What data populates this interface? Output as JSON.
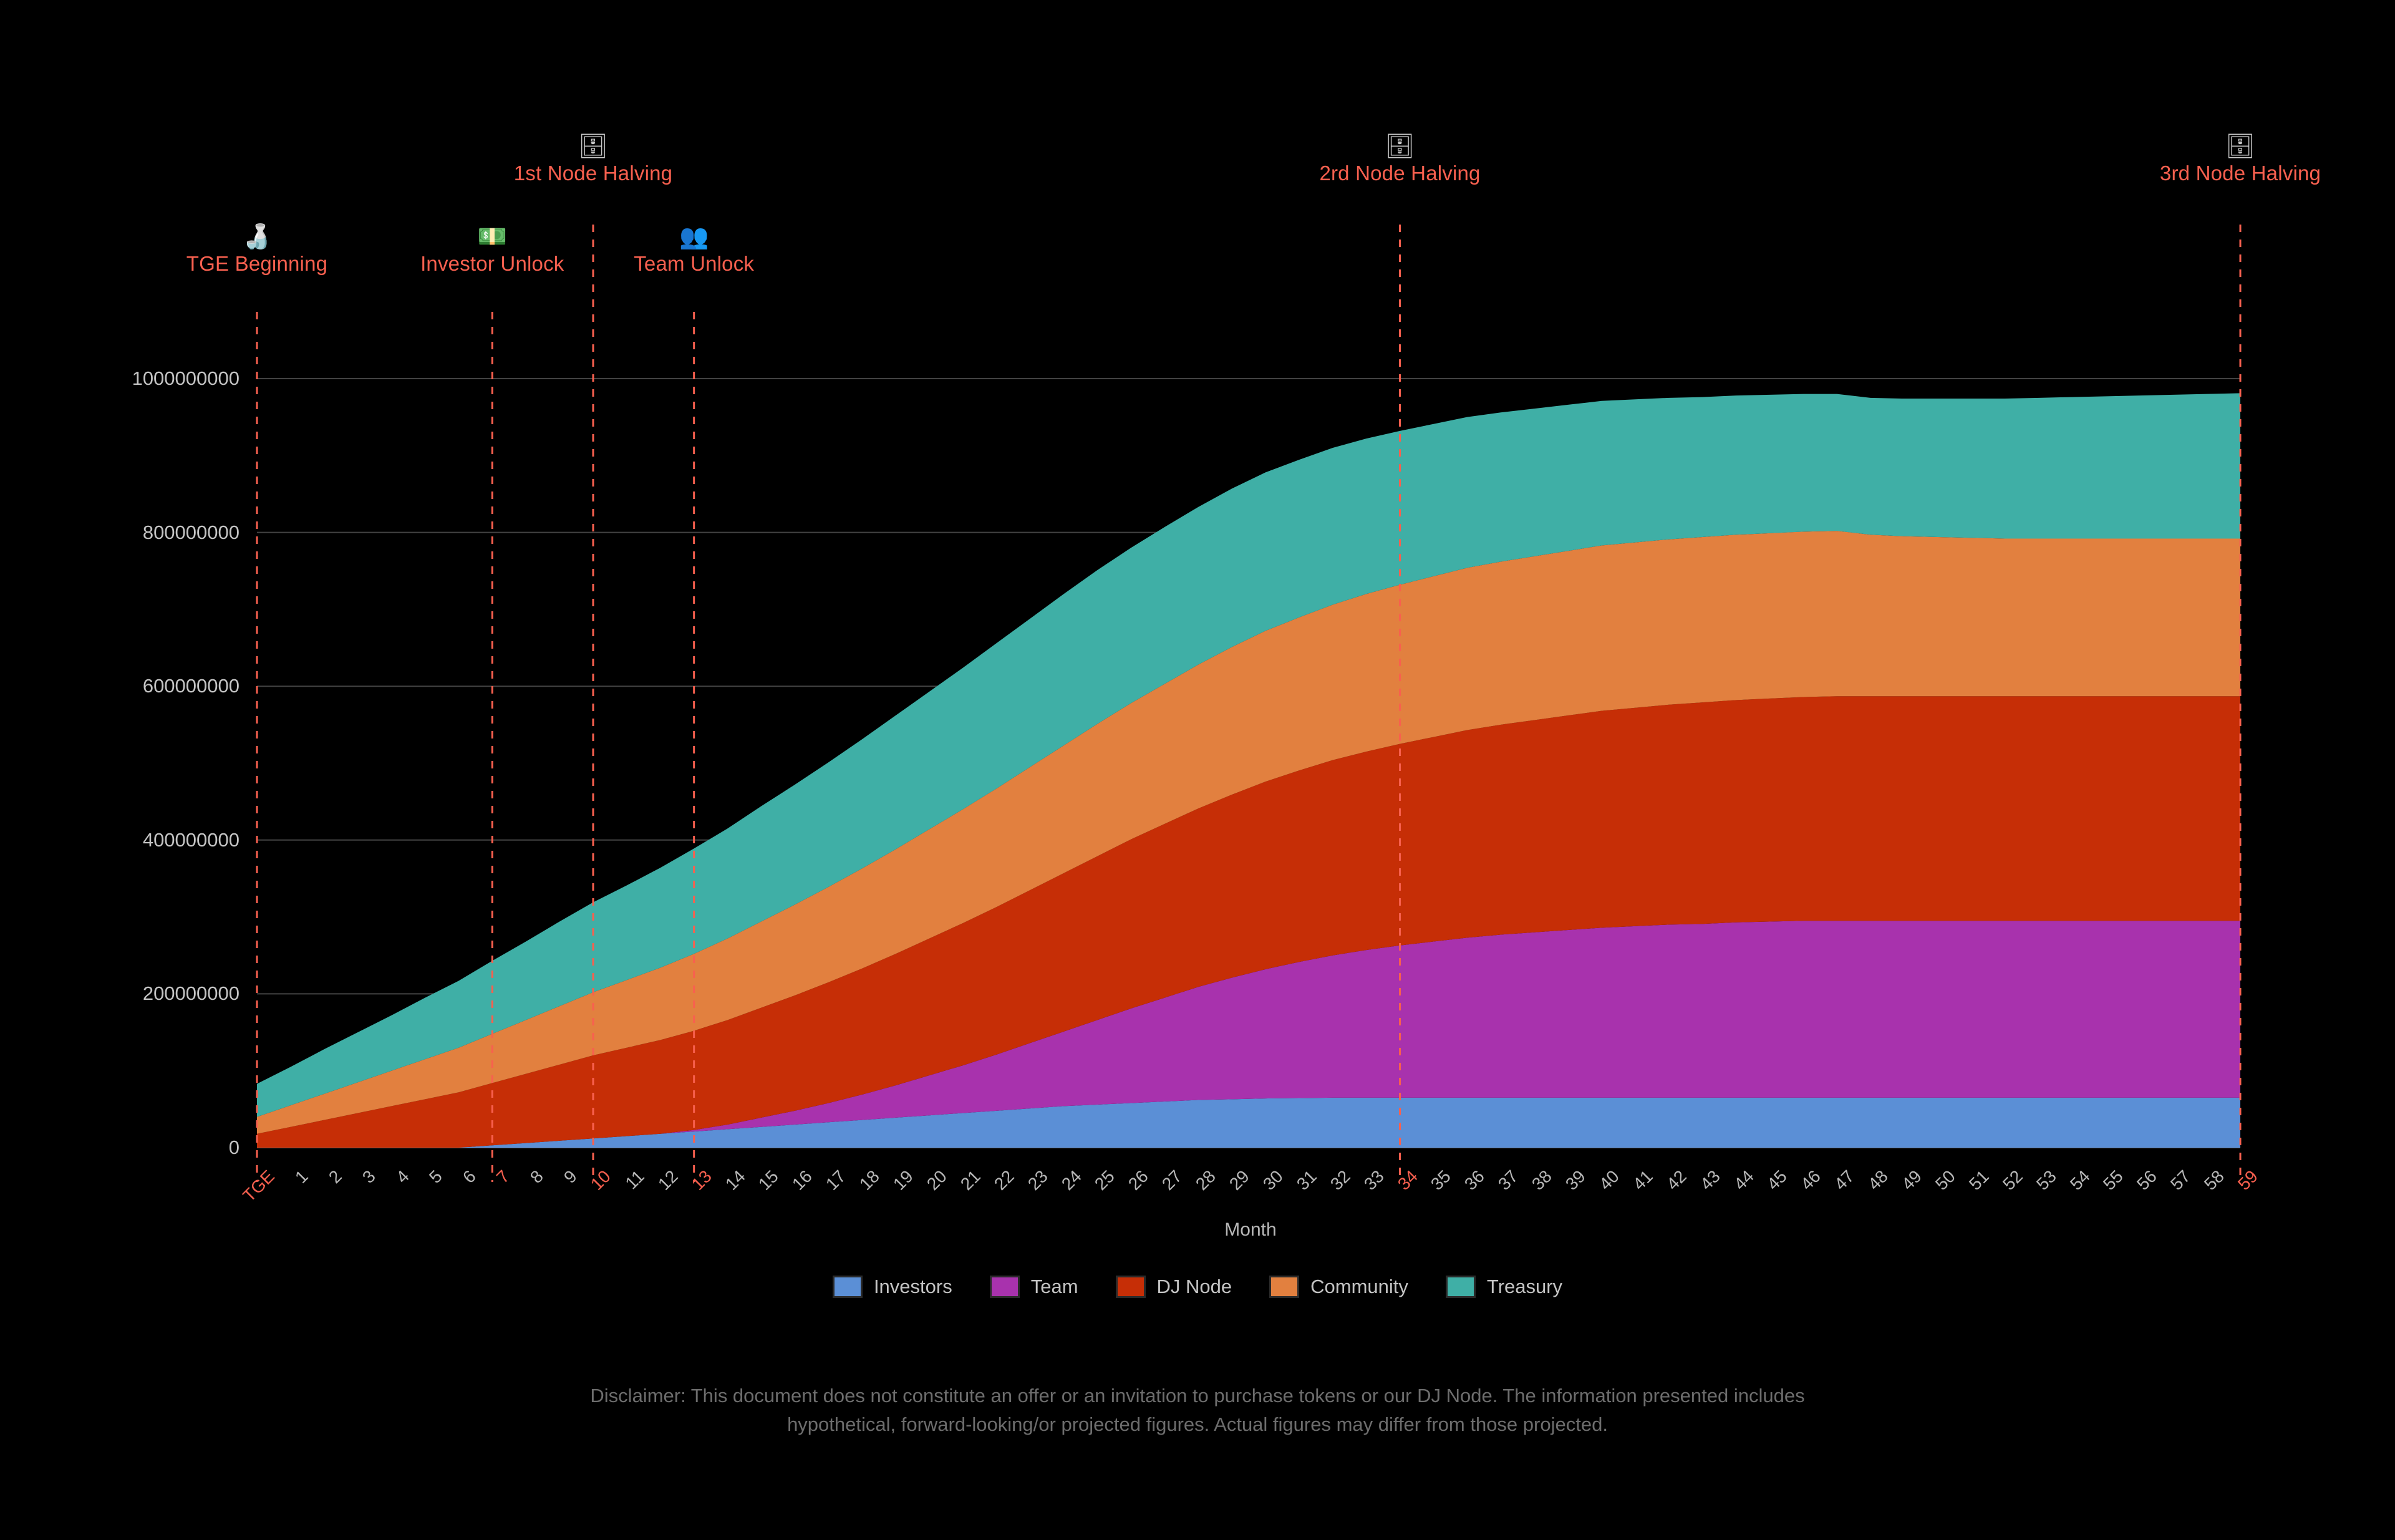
{
  "axis": {
    "x_title": "Month",
    "y_ticks": [
      "0",
      "200000000",
      "400000000",
      "600000000",
      "800000000",
      "1000000000"
    ],
    "x_ticks": [
      "TGE",
      "1",
      "2",
      "3",
      "4",
      "5",
      "6",
      "7",
      "8",
      "9",
      "10",
      "11",
      "12",
      "13",
      "14",
      "15",
      "16",
      "17",
      "18",
      "19",
      "20",
      "21",
      "22",
      "23",
      "24",
      "25",
      "26",
      "27",
      "28",
      "29",
      "30",
      "31",
      "32",
      "33",
      "34",
      "35",
      "36",
      "37",
      "38",
      "39",
      "40",
      "41",
      "42",
      "43",
      "44",
      "45",
      "46",
      "47",
      "48",
      "49",
      "50",
      "51",
      "52",
      "53",
      "54",
      "55",
      "56",
      "57",
      "58",
      "59"
    ],
    "highlighted_x_ticks": [
      "TGE",
      "7",
      "10",
      "13",
      "34",
      "59"
    ]
  },
  "annotations": [
    {
      "label": "TGE Beginning",
      "icon": "token-bottle-icon",
      "glyph": "🍶",
      "month": 0,
      "row": "lower"
    },
    {
      "label": "Investor Unlock",
      "icon": "money-icon",
      "glyph": "💵",
      "month": 7,
      "row": "lower"
    },
    {
      "label": "1st Node Halving",
      "icon": "node-box-icon",
      "glyph": "🗄",
      "month": 10,
      "row": "upper"
    },
    {
      "label": "Team Unlock",
      "icon": "team-people-icon",
      "glyph": "👥",
      "month": 13,
      "row": "lower"
    },
    {
      "label": "2rd Node Halving",
      "icon": "node-box-icon",
      "glyph": "🗄",
      "month": 34,
      "row": "upper"
    },
    {
      "label": "3rd Node Halving",
      "icon": "node-box-icon",
      "glyph": "🗄",
      "month": 59,
      "row": "upper"
    }
  ],
  "legend": [
    {
      "label": "Investors",
      "color": "#5B8FD6"
    },
    {
      "label": "Team",
      "color": "#A832AD"
    },
    {
      "label": "DJ Node",
      "color": "#C62E06"
    },
    {
      "label": "Community",
      "color": "#E2803F"
    },
    {
      "label": "Treasury",
      "color": "#3FAFA6"
    }
  ],
  "disclaimer": "Disclaimer: This document does not constitute an offer or an invitation to purchase tokens or our DJ Node. The information presented includes hypothetical, forward-looking/or projected figures. Actual figures may differ from those projected.",
  "colors": {
    "background": "#000000",
    "grid": "#7a7a7a",
    "annotation": "#f8604f",
    "text": "#c4c4c4",
    "disclaimer": "#6d6d6d"
  },
  "chart_data": {
    "type": "area",
    "stacked": true,
    "title": "",
    "xlabel": "Month",
    "ylabel": "",
    "xlim": [
      0,
      59
    ],
    "ylim": [
      0,
      1000000000
    ],
    "grid": true,
    "legend_position": "bottom",
    "x": [
      0,
      1,
      2,
      3,
      4,
      5,
      6,
      7,
      8,
      9,
      10,
      11,
      12,
      13,
      14,
      15,
      16,
      17,
      18,
      19,
      20,
      21,
      22,
      23,
      24,
      25,
      26,
      27,
      28,
      29,
      30,
      31,
      32,
      33,
      34,
      35,
      36,
      37,
      38,
      39,
      40,
      41,
      42,
      43,
      44,
      45,
      46,
      47,
      48,
      49,
      50,
      51,
      52,
      53,
      54,
      55,
      56,
      57,
      58,
      59
    ],
    "x_labels": [
      "TGE",
      "1",
      "2",
      "3",
      "4",
      "5",
      "6",
      "7",
      "8",
      "9",
      "10",
      "11",
      "12",
      "13",
      "14",
      "15",
      "16",
      "17",
      "18",
      "19",
      "20",
      "21",
      "22",
      "23",
      "24",
      "25",
      "26",
      "27",
      "28",
      "29",
      "30",
      "31",
      "32",
      "33",
      "34",
      "35",
      "36",
      "37",
      "38",
      "39",
      "40",
      "41",
      "42",
      "43",
      "44",
      "45",
      "46",
      "47",
      "48",
      "49",
      "50",
      "51",
      "52",
      "53",
      "54",
      "55",
      "56",
      "57",
      "58",
      "59"
    ],
    "series": [
      {
        "name": "Investors",
        "color": "#5B8FD6",
        "values": [
          0,
          0,
          0,
          0,
          0,
          0,
          0,
          3000000,
          6000000,
          9000000,
          12000000,
          15000000,
          18000000,
          21000000,
          24000000,
          27000000,
          30000000,
          33000000,
          36000000,
          39000000,
          42000000,
          45000000,
          48000000,
          51000000,
          54000000,
          56000000,
          58000000,
          60000000,
          62000000,
          63000000,
          64000000,
          64500000,
          65000000,
          65000000,
          65000000,
          65000000,
          65000000,
          65000000,
          65000000,
          65000000,
          65000000,
          65000000,
          65000000,
          65000000,
          65000000,
          65000000,
          65000000,
          65000000,
          65000000,
          65000000,
          65000000,
          65000000,
          65000000,
          65000000,
          65000000,
          65000000,
          65000000,
          65000000,
          65000000,
          65000000
        ]
      },
      {
        "name": "Team",
        "color": "#A832AD",
        "values": [
          0,
          0,
          0,
          0,
          0,
          0,
          0,
          0,
          0,
          0,
          0,
          0,
          0,
          2000000,
          6000000,
          12000000,
          18000000,
          25000000,
          33000000,
          42000000,
          52000000,
          62000000,
          73000000,
          85000000,
          97000000,
          110000000,
          123000000,
          135000000,
          147000000,
          158000000,
          168000000,
          177000000,
          185000000,
          192000000,
          198000000,
          203000000,
          208000000,
          212000000,
          215000000,
          218000000,
          221000000,
          223000000,
          225000000,
          226000000,
          228000000,
          229000000,
          230000000,
          230000000,
          230000000,
          230000000,
          230000000,
          230000000,
          230000000,
          230000000,
          230000000,
          230000000,
          230000000,
          230000000,
          230000000,
          230000000
        ]
      },
      {
        "name": "DJ Node",
        "color": "#C62E06",
        "values": [
          18000000,
          27000000,
          36000000,
          45000000,
          54000000,
          63000000,
          72000000,
          81000000,
          90000000,
          99000000,
          108000000,
          115000000,
          122000000,
          129000000,
          136000000,
          143000000,
          150000000,
          157000000,
          164000000,
          171000000,
          178000000,
          185000000,
          192000000,
          199000000,
          206000000,
          213000000,
          220000000,
          226000000,
          232000000,
          238000000,
          244000000,
          249000000,
          254000000,
          258000000,
          262000000,
          266000000,
          270000000,
          273000000,
          276000000,
          279000000,
          282000000,
          284000000,
          286000000,
          288000000,
          289000000,
          290000000,
          291000000,
          292000000,
          292000000,
          292000000,
          292000000,
          292000000,
          292000000,
          292000000,
          292000000,
          292000000,
          292000000,
          292000000,
          292000000,
          292000000
        ]
      },
      {
        "name": "Community",
        "color": "#E2803F",
        "values": [
          22000000,
          28000000,
          34000000,
          40000000,
          46000000,
          52000000,
          58000000,
          64000000,
          70000000,
          76000000,
          82000000,
          88000000,
          94000000,
          100000000,
          106000000,
          112000000,
          118000000,
          124000000,
          130000000,
          136000000,
          142000000,
          148000000,
          154000000,
          160000000,
          166000000,
          172000000,
          177000000,
          182000000,
          187000000,
          192000000,
          196000000,
          199000000,
          202000000,
          205000000,
          207000000,
          209000000,
          211000000,
          212000000,
          213000000,
          214000000,
          215000000,
          215000000,
          215000000,
          215000000,
          215000000,
          215000000,
          215000000,
          215000000,
          210000000,
          208000000,
          207000000,
          206000000,
          205000000,
          205000000,
          205000000,
          205000000,
          205000000,
          205000000,
          205000000,
          205000000
        ]
      },
      {
        "name": "Treasury",
        "color": "#3FAFA6",
        "values": [
          43000000,
          50000000,
          58000000,
          65000000,
          72000000,
          80000000,
          87000000,
          95000000,
          102000000,
          110000000,
          117000000,
          123000000,
          130000000,
          137000000,
          143000000,
          150000000,
          156000000,
          162000000,
          168000000,
          174000000,
          179000000,
          184000000,
          189000000,
          193000000,
          197000000,
          200000000,
          202000000,
          204000000,
          205000000,
          206000000,
          206000000,
          205000000,
          204000000,
          202000000,
          200000000,
          198000000,
          196000000,
          194000000,
          192000000,
          190000000,
          188000000,
          186000000,
          184000000,
          182000000,
          181000000,
          180000000,
          179000000,
          178000000,
          178000000,
          179000000,
          180000000,
          181000000,
          182000000,
          183000000,
          184000000,
          185000000,
          186000000,
          187000000,
          188000000,
          189000000
        ]
      }
    ]
  }
}
